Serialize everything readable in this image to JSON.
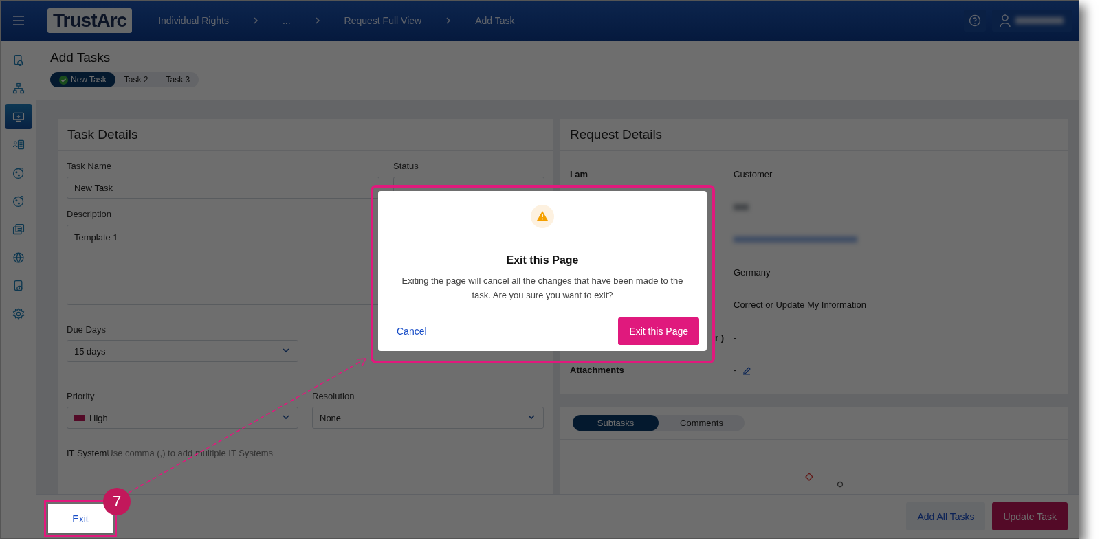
{
  "header": {
    "logo": "TrustArc",
    "breadcrumbs": [
      {
        "label": "Individual Rights"
      },
      {
        "label": "..."
      },
      {
        "label": "Request Full View"
      },
      {
        "label": "Add Task"
      }
    ],
    "user": {
      "redacted": true
    }
  },
  "sidebar": {
    "items": [
      {
        "selected": false
      },
      {
        "selected": false
      },
      {
        "selected": true
      },
      {
        "selected": false
      },
      {
        "selected": false
      },
      {
        "selected": false
      },
      {
        "selected": false
      },
      {
        "selected": false
      },
      {
        "selected": false
      },
      {
        "selected": false
      }
    ]
  },
  "page": {
    "title": "Add Tasks",
    "task_tabs": [
      {
        "label": "New Task",
        "selected": true,
        "done": true
      },
      {
        "label": "Task 2",
        "selected": false,
        "done": false
      },
      {
        "label": "Task 3",
        "selected": false,
        "done": false
      }
    ]
  },
  "task_details": {
    "title": "Task Details",
    "task_name": {
      "label": "Task Name",
      "value": "New Task"
    },
    "status": {
      "label": "Status"
    },
    "description": {
      "label": "Description",
      "value": "Template 1"
    },
    "due_days": {
      "label": "Due Days",
      "value": "15 days"
    },
    "priority": {
      "label": "Priority",
      "value": "High",
      "color": "#530a27"
    },
    "resolution": {
      "label": "Resolution",
      "value": "None"
    },
    "it_system": {
      "label": "IT System",
      "hint": "Use comma (,) to add multiple IT Systems"
    }
  },
  "request_details": {
    "title": "Request Details",
    "rows": [
      {
        "label": "I am",
        "value": "Customer",
        "redacted": false,
        "editable": false
      },
      {
        "redacted": true,
        "kind": "text",
        "editable": false
      },
      {
        "redacted": true,
        "kind": "link",
        "editable": false
      },
      {
        "value": "Germany",
        "redacted": false,
        "editable": false
      },
      {
        "value": "Correct or Update My Information",
        "redacted": false,
        "editable": false
      },
      {
        "label": "r )",
        "value": "-",
        "redacted": false,
        "editable": false
      },
      {
        "label": "Attachments",
        "value": "-",
        "redacted": false,
        "editable": true
      }
    ]
  },
  "activity": {
    "tabs": [
      {
        "label": "Subtasks",
        "selected": true
      },
      {
        "label": "Comments",
        "selected": false
      }
    ]
  },
  "footer": {
    "exit": "Exit",
    "buttons": [
      {
        "label": "Add All Tasks",
        "kind": "secondary"
      },
      {
        "label": "Update Task",
        "kind": "primary"
      }
    ]
  },
  "dialog": {
    "title": "Exit this Page",
    "message": "Exiting the page will cancel all the changes that have been made to the task. Are you sure you want to exit?",
    "cancel": "Cancel",
    "confirm": "Exit this Page"
  },
  "callout": {
    "step": "7"
  }
}
